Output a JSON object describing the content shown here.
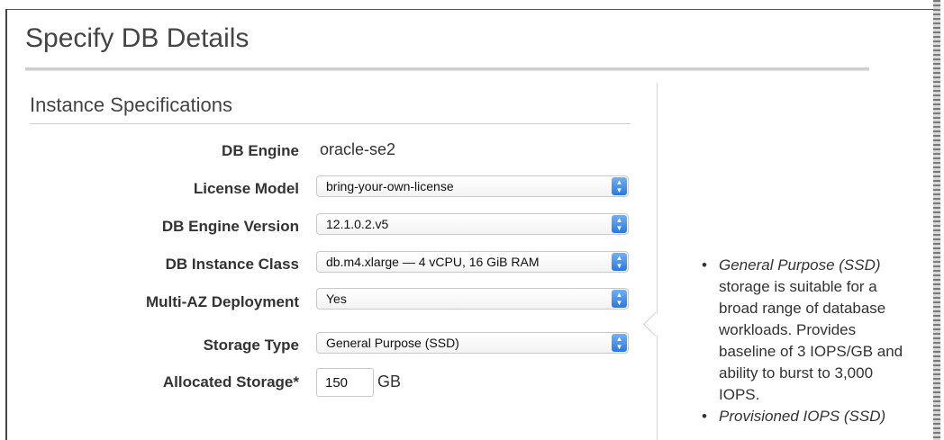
{
  "page": {
    "title": "Specify DB Details"
  },
  "section": {
    "title": "Instance Specifications"
  },
  "fields": {
    "db_engine": {
      "label": "DB Engine",
      "value": "oracle-se2"
    },
    "license_model": {
      "label": "License Model",
      "value": "bring-your-own-license"
    },
    "db_engine_version": {
      "label": "DB Engine Version",
      "value": "12.1.0.2.v5"
    },
    "db_instance_class": {
      "label": "DB Instance Class",
      "value": "db.m4.xlarge — 4 vCPU, 16 GiB RAM"
    },
    "multi_az": {
      "label": "Multi-AZ Deployment",
      "value": "Yes"
    },
    "storage_type": {
      "label": "Storage Type",
      "value": "General Purpose (SSD)"
    },
    "allocated_storage": {
      "label": "Allocated Storage*",
      "value": "150",
      "unit": "GB"
    }
  },
  "help": {
    "items": [
      {
        "emphasis": "General Purpose (SSD)",
        "text": " storage is suitable for a broad range of database workloads. Provides baseline of 3 IOPS/GB and ability to burst to 3,000 IOPS."
      },
      {
        "emphasis": "Provisioned IOPS (SSD)",
        "text": ""
      }
    ]
  },
  "icons": {
    "select_stepper": "up-down-chevron-icon",
    "bullet": "bullet-icon"
  },
  "colors": {
    "stepper_blue": "#2a79e0",
    "border": "#c9c9c9",
    "text": "#333333"
  }
}
